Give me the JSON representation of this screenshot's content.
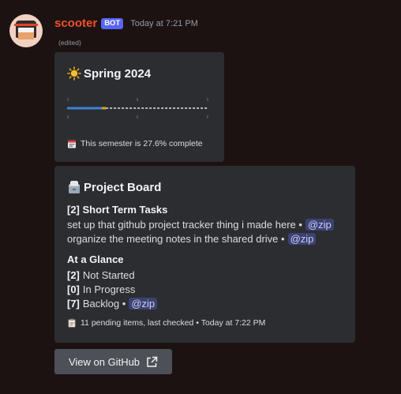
{
  "message": {
    "username": "scooter",
    "bot_tag": "BOT",
    "timestamp": "Today at 7:21 PM",
    "edited": "(edited)"
  },
  "semester_embed": {
    "title_icon": "sun-icon",
    "title": "Spring 2024",
    "progress_fraction": 0.276,
    "progress_color": "#3b82d6",
    "progress_marker_color": "#e0a31a",
    "footer_icon": "calendar-icon",
    "footer": "This semester is 27.6% complete"
  },
  "project_embed": {
    "title_icon": "card-file-box-icon",
    "title": "Project Board",
    "short_term_heading": "[2] Short Term Tasks",
    "tasks": [
      {
        "text": "set up that github project tracker thing i made here •",
        "mention": "@zip"
      },
      {
        "text": "organize the meeting notes in the shared drive •",
        "mention": "@zip"
      }
    ],
    "glance_heading": "At a Glance",
    "glance": [
      {
        "count": "[2]",
        "label": "Not Started",
        "mention": ""
      },
      {
        "count": "[0]",
        "label": "In Progress",
        "mention": ""
      },
      {
        "count": "[7]",
        "label": "Backlog •",
        "mention": "@zip"
      }
    ],
    "footer_icon": "clipboard-icon",
    "footer": "11 pending items, last checked • Today at 7:22 PM"
  },
  "button": {
    "label": "View on GitHub",
    "icon": "external-link-icon"
  },
  "colors": {
    "background": "#1c1212",
    "embed": "#2b2d31",
    "username": "#f0522c",
    "bot_tag": "#5865f2",
    "mention_bg": "#3c4270"
  }
}
